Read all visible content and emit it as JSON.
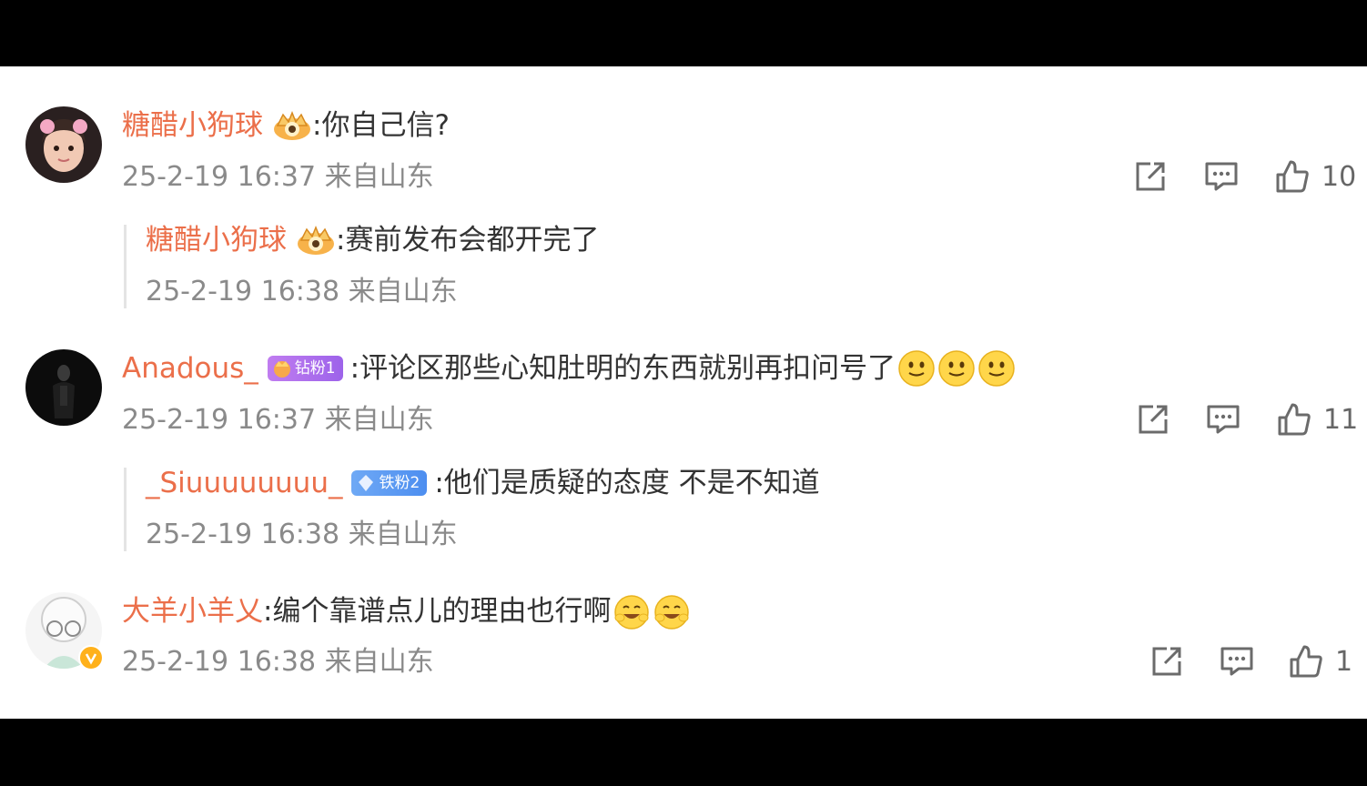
{
  "comments": [
    {
      "username": "糖醋小狗球",
      "text": ":你自己信?",
      "meta": "25-2-19 16:37 来自山东",
      "likes": "10",
      "reply": {
        "username": "糖醋小狗球",
        "text": ":赛前发布会都开完了",
        "meta": "25-2-19 16:38 来自山东"
      }
    },
    {
      "username": "Anadous_",
      "fan_badge": "钻粉1",
      "text": ":评论区那些心知肚明的东西就别再扣问号了",
      "meta": "25-2-19 16:37 来自山东",
      "likes": "11",
      "reply": {
        "username": "_Siuuuuuuuu_",
        "fan_badge": "铁粉2",
        "text": ":他们是质疑的态度  不是不知道",
        "meta": "25-2-19 16:38 来自山东"
      }
    },
    {
      "username": "大羊小羊乂",
      "text": ":编个靠谱点儿的理由也行啊",
      "meta": "25-2-19 16:38 来自山东",
      "likes": "1"
    }
  ],
  "icons": {
    "share": "share-icon",
    "comment": "comment-icon",
    "like": "thumbs-up-icon",
    "smile": "smile-emoji-icon",
    "laugh": "laugh-emoji-icon",
    "crown": "crown-badge-icon",
    "verified": "verified-v-icon"
  },
  "colors": {
    "username": "#eb6f4a",
    "meta": "#8a8a8a",
    "text": "#333333",
    "background": "#ffffff",
    "frame": "#000000"
  }
}
